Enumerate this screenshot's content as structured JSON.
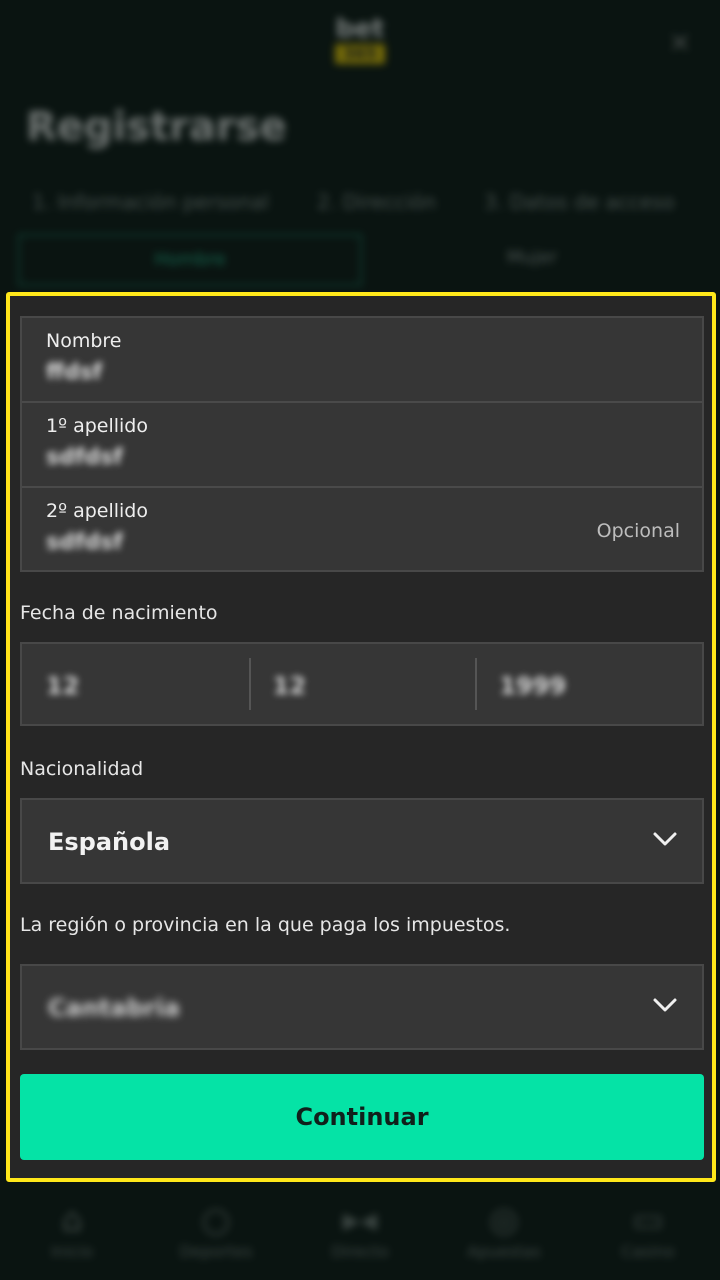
{
  "header": {
    "logo_top": "bet",
    "logo_bottom": "365",
    "close_glyph": "×",
    "title": "Registrarse"
  },
  "steps": [
    {
      "label": "1. Información personal"
    },
    {
      "label": "2. Dirección"
    },
    {
      "label": "3. Datos de acceso"
    }
  ],
  "gender": {
    "male": "Hombre",
    "female": "Mujer"
  },
  "form": {
    "first_name": {
      "label": "Nombre",
      "value": "ffdsf"
    },
    "surname1": {
      "label": "1º apellido",
      "value": "sdfdsf"
    },
    "surname2": {
      "label": "2º apellido",
      "value": "sdfdsf",
      "optional": "Opcional"
    },
    "dob": {
      "label": "Fecha de nacimiento",
      "day": "12",
      "month": "12",
      "year": "1999"
    },
    "nationality": {
      "label": "Nacionalidad",
      "value": "Española"
    },
    "region": {
      "label": "La región o provincia en la que paga los impuestos.",
      "value": "Cantabria"
    },
    "continue_label": "Continuar"
  },
  "bottom_nav": [
    {
      "label": "Inicio",
      "icon": "home-icon"
    },
    {
      "label": "Deportes",
      "icon": "search-icon"
    },
    {
      "label": "Directo",
      "icon": "live-icon"
    },
    {
      "label": "Apuestas",
      "icon": "bets-icon"
    },
    {
      "label": "Casino",
      "icon": "casino-icon"
    }
  ],
  "colors": {
    "highlight_border": "#ffe81a",
    "accent": "#05e3a6"
  }
}
